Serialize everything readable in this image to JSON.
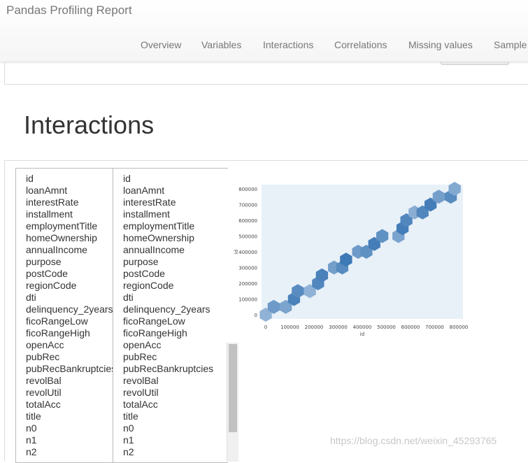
{
  "brand": "Pandas Profiling Report",
  "nav": [
    "Overview",
    "Variables",
    "Interactions",
    "Correlations",
    "Missing values",
    "Sample"
  ],
  "section_title": "Interactions",
  "variables_left": [
    "id",
    "loanAmnt",
    "interestRate",
    "installment",
    "employmentTitle",
    "homeOwnership",
    "annualIncome",
    "purpose",
    "postCode",
    "regionCode",
    "dti",
    "delinquency_2years",
    "ficoRangeLow",
    "ficoRangeHigh",
    "openAcc",
    "pubRec",
    "pubRecBankruptcies",
    "revolBal",
    "revolUtil",
    "totalAcc",
    "title",
    "n0",
    "n1",
    "n2"
  ],
  "variables_right": [
    "id",
    "loanAmnt",
    "interestRate",
    "installment",
    "employmentTitle",
    "homeOwnership",
    "annualIncome",
    "purpose",
    "postCode",
    "regionCode",
    "dti",
    "delinquency_2years",
    "ficoRangeLow",
    "ficoRangeHigh",
    "openAcc",
    "pubRec",
    "pubRecBankruptcies",
    "revolBal",
    "revolUtil",
    "totalAcc",
    "title",
    "n0",
    "n1",
    "n2"
  ],
  "chart_data": {
    "type": "heatmap",
    "subtype": "hexbin",
    "xlabel": "id",
    "ylabel": "id",
    "xlim": [
      0,
      800000
    ],
    "ylim": [
      0,
      800000
    ],
    "xticks": [
      0,
      100000,
      200000,
      300000,
      400000,
      500000,
      600000,
      700000,
      800000
    ],
    "yticks": [
      0,
      100000,
      200000,
      300000,
      400000,
      500000,
      600000,
      700000,
      800000
    ],
    "bins": [
      {
        "x": 0,
        "y": 0,
        "density": 0.3
      },
      {
        "x": 33000,
        "y": 50000,
        "density": 0.55
      },
      {
        "x": 83000,
        "y": 50000,
        "density": 0.45
      },
      {
        "x": 117000,
        "y": 100000,
        "density": 0.8
      },
      {
        "x": 133000,
        "y": 150000,
        "density": 0.7
      },
      {
        "x": 183000,
        "y": 150000,
        "density": 0.3
      },
      {
        "x": 217000,
        "y": 200000,
        "density": 0.75
      },
      {
        "x": 233000,
        "y": 250000,
        "density": 0.8
      },
      {
        "x": 283000,
        "y": 300000,
        "density": 0.5
      },
      {
        "x": 317000,
        "y": 300000,
        "density": 0.7
      },
      {
        "x": 333000,
        "y": 350000,
        "density": 0.9
      },
      {
        "x": 383000,
        "y": 400000,
        "density": 0.55
      },
      {
        "x": 417000,
        "y": 400000,
        "density": 0.65
      },
      {
        "x": 450000,
        "y": 450000,
        "density": 0.85
      },
      {
        "x": 483000,
        "y": 500000,
        "density": 0.65
      },
      {
        "x": 550000,
        "y": 500000,
        "density": 0.45
      },
      {
        "x": 567000,
        "y": 550000,
        "density": 0.85
      },
      {
        "x": 583000,
        "y": 600000,
        "density": 0.75
      },
      {
        "x": 617000,
        "y": 650000,
        "density": 0.35
      },
      {
        "x": 650000,
        "y": 650000,
        "density": 0.75
      },
      {
        "x": 683000,
        "y": 700000,
        "density": 0.85
      },
      {
        "x": 717000,
        "y": 750000,
        "density": 0.5
      },
      {
        "x": 767000,
        "y": 750000,
        "density": 0.7
      },
      {
        "x": 783000,
        "y": 800000,
        "density": 0.4
      }
    ],
    "colors": {
      "background": "#e8f0f8",
      "low": "#b9cfe6",
      "high": "#2f6fb0"
    }
  },
  "watermark": "https://blog.csdn.net/weixin_45293765"
}
